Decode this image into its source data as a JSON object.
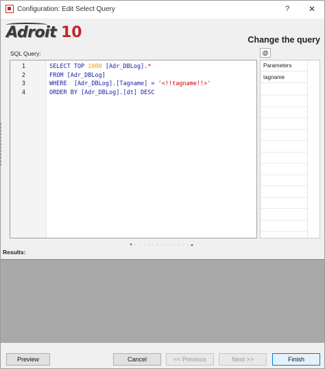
{
  "window": {
    "title": "Configuration: Edit Select Query",
    "help": "?",
    "close": "✕"
  },
  "logo": {
    "word": "Adroit",
    "number": "10"
  },
  "heading": "Change the query",
  "sql_label": "SQL Query:",
  "at_button": "@",
  "editor": {
    "line_numbers": [
      "1",
      "2",
      "3",
      "4"
    ],
    "lines": [
      [
        {
          "t": "SELECT TOP ",
          "c": "kw"
        },
        {
          "t": "1000",
          "c": "num"
        },
        {
          "t": " [Adr_DBLog].",
          "c": "plain"
        },
        {
          "t": "*",
          "c": "str"
        }
      ],
      [
        {
          "t": "FROM [Adr_DBLog]",
          "c": "kw"
        }
      ],
      [
        {
          "t": "WHERE  [Adr_DBLog].[Tagname] = ",
          "c": "kw"
        },
        {
          "t": "'<!!tagname!!>'",
          "c": "str"
        }
      ],
      [
        {
          "t": "ORDER BY [Adr_DBLog].[dt] DESC",
          "c": "kw"
        }
      ]
    ]
  },
  "params": {
    "header": "Parameters",
    "rows": [
      "tagname"
    ]
  },
  "splitter": "▾ · · · · · · · · · · · · · ▴",
  "results_label": "Results:",
  "buttons": {
    "preview": "Preview",
    "cancel": "Cancel",
    "previous": "<< Previous",
    "next": "Next >>",
    "finish": "Finish"
  },
  "colors": {
    "keyword": "#1a1aa6",
    "number": "#e8a200",
    "string": "#d40000",
    "logo_accent": "#c0282b",
    "results_bg": "#a9a9a9"
  }
}
